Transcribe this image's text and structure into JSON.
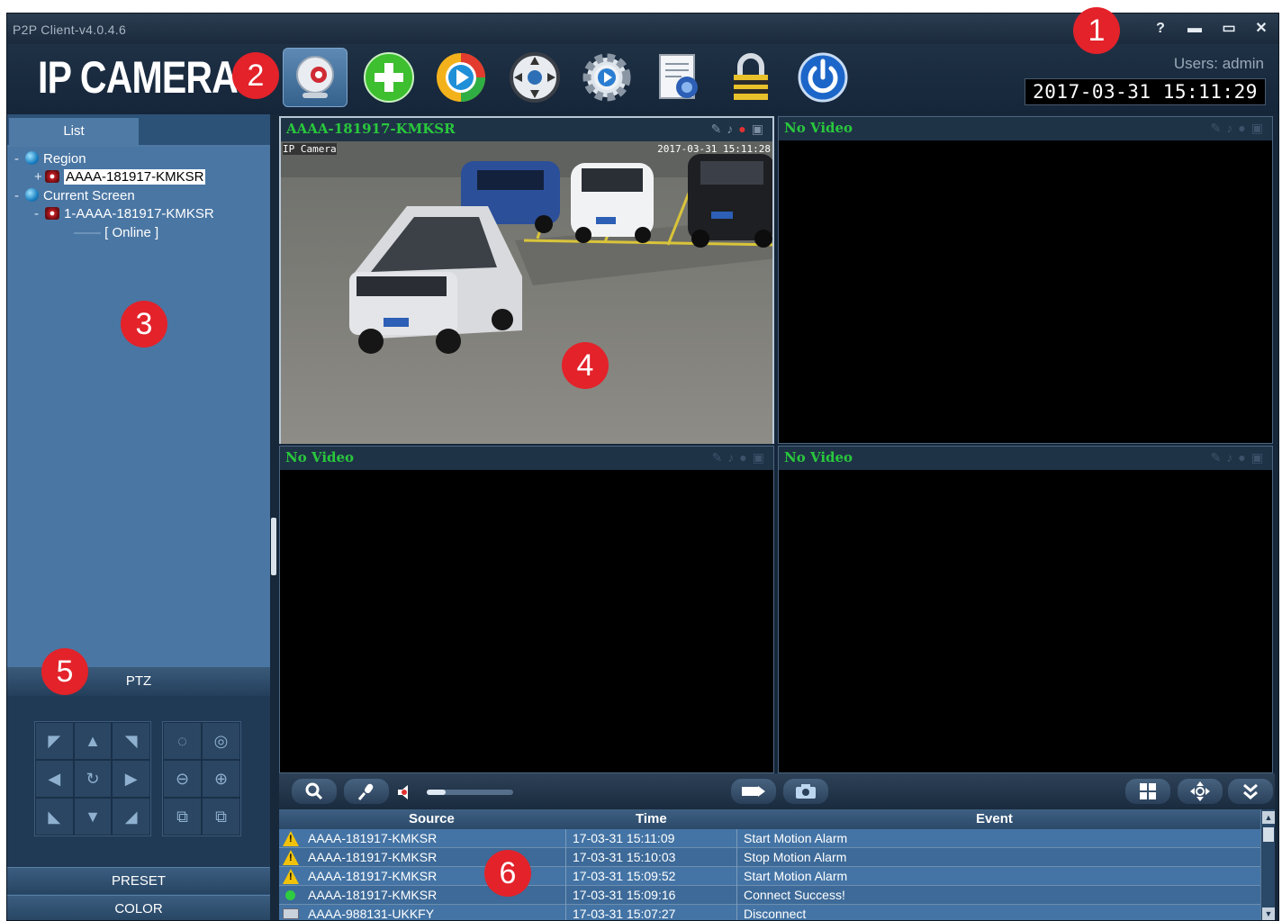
{
  "window": {
    "title": "P2P Client-v4.0.4.6",
    "help_label": "?",
    "minimize_label": "▬",
    "maximize_label": "▭",
    "close_label": "✕"
  },
  "toolbar": {
    "logo": "IP CAMERA",
    "buttons": [
      "webcam-icon",
      "add-icon",
      "playback-icon",
      "ptz-control-icon",
      "settings-gear-icon",
      "log-report-icon",
      "lock-icon",
      "power-icon"
    ],
    "users": "Users: admin",
    "datetime": "2017-03-31  15:11:29"
  },
  "badges": [
    "1",
    "2",
    "3",
    "4",
    "5",
    "6"
  ],
  "sidebar": {
    "tab": "List",
    "tree": {
      "region": "Region",
      "region_device": "AAAA-181917-KMKSR",
      "current_screen": "Current Screen",
      "screen_device": "1-AAAA-181917-KMKSR",
      "status": "[   Online   ]"
    },
    "ptz_label": "PTZ",
    "preset_label": "PRESET",
    "color_label": "COLOR"
  },
  "video": {
    "panes": [
      {
        "name": "AAAA-181917-KMKSR",
        "osd_left": "IP Camera",
        "osd_right": "2017-03-31 15:11:28"
      },
      {
        "name": "No Video"
      },
      {
        "name": "No Video"
      },
      {
        "name": "No Video"
      }
    ],
    "volume": 0.22
  },
  "log": {
    "headers": {
      "source": "Source",
      "time": "Time",
      "event": "Event"
    },
    "rows": [
      {
        "icon": "warning",
        "source": "AAAA-181917-KMKSR",
        "time": "17-03-31 15:11:09",
        "event": "Start Motion Alarm"
      },
      {
        "icon": "warning",
        "source": "AAAA-181917-KMKSR",
        "time": "17-03-31 15:10:03",
        "event": "Stop Motion Alarm"
      },
      {
        "icon": "warning",
        "source": "AAAA-181917-KMKSR",
        "time": "17-03-31 15:09:52",
        "event": "Start Motion Alarm"
      },
      {
        "icon": "connected",
        "source": "AAAA-181917-KMKSR",
        "time": "17-03-31 15:09:16",
        "event": "Connect Success!"
      },
      {
        "icon": "disconnected",
        "source": "AAAA-988131-UKKFY",
        "time": "17-03-31 15:07:27",
        "event": "Disconnect"
      }
    ]
  },
  "colors": {
    "accent_green": "#29c83c",
    "badge_red": "#e3222a",
    "panel_blue": "#4a76a3"
  }
}
